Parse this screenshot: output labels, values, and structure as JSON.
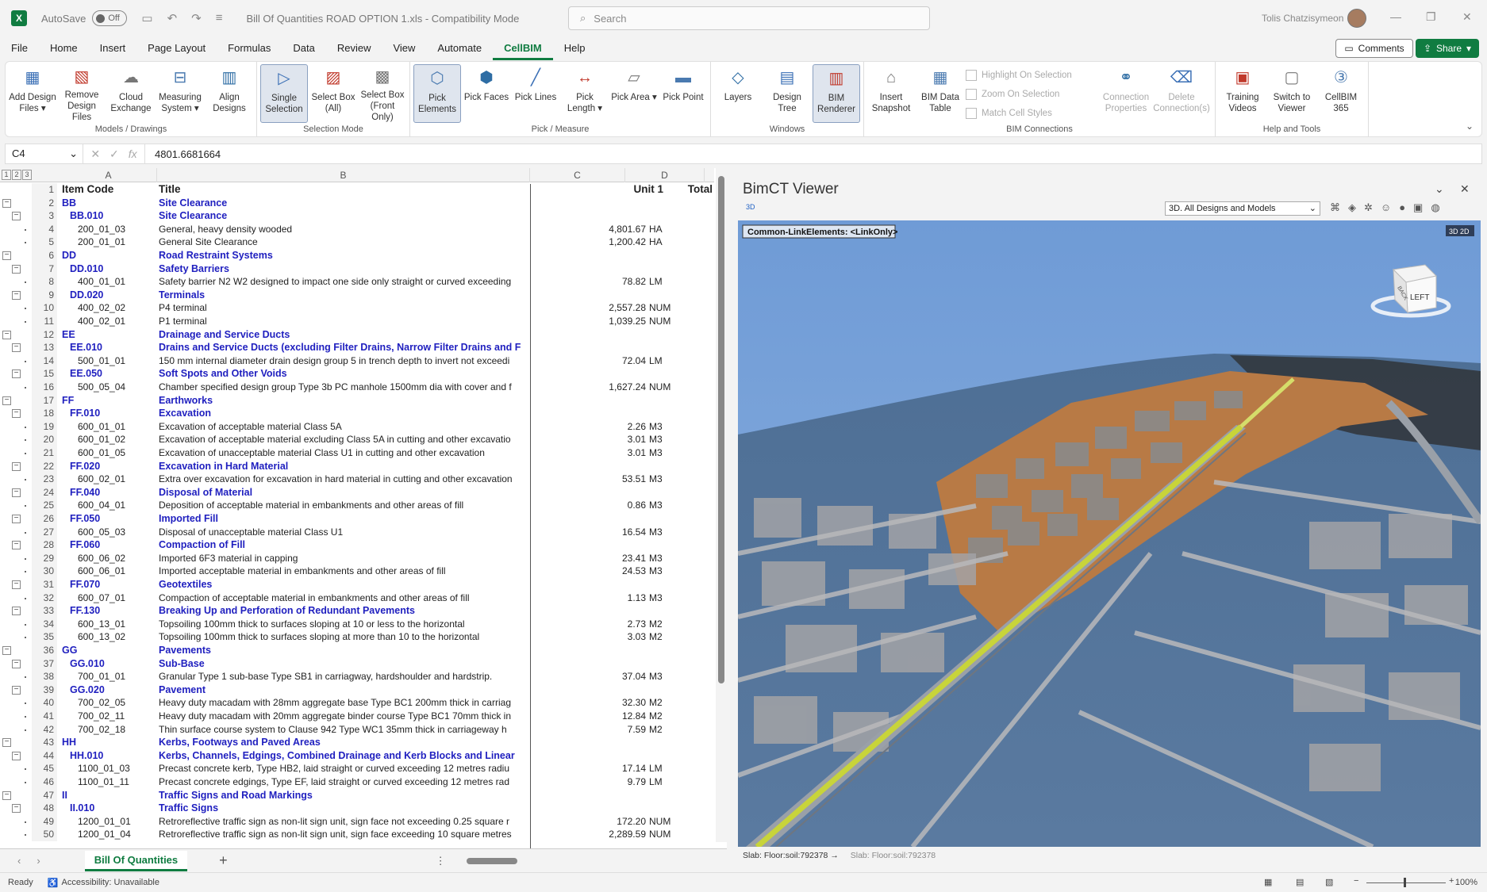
{
  "titlebar": {
    "app_logo": "X",
    "autosave_label": "AutoSave",
    "autosave_state": "Off",
    "doc_title": "Bill Of Quantities ROAD OPTION 1.xls - Compatibility Mode",
    "search_placeholder": "Search",
    "user_name": "Tolis Chatzisymeon"
  },
  "menu": {
    "items": [
      "File",
      "Home",
      "Insert",
      "Page Layout",
      "Formulas",
      "Data",
      "Review",
      "View",
      "Automate",
      "CellBIM",
      "Help"
    ],
    "active": "CellBIM",
    "comments_label": "Comments",
    "share_label": "Share"
  },
  "ribbon": {
    "groups": [
      {
        "label": "Models / Drawings",
        "buttons": [
          "Add Design Files ▾",
          "Remove Design Files",
          "Cloud Exchange",
          "Measuring System ▾",
          "Align Designs"
        ]
      },
      {
        "label": "Selection Mode",
        "buttons": [
          "Single Selection",
          "Select Box (All)",
          "Select Box (Front Only)"
        ]
      },
      {
        "label": "Pick / Measure",
        "buttons": [
          "Pick Elements",
          "Pick Faces",
          "Pick Lines",
          "Pick Length ▾",
          "Pick Area ▾",
          "Pick Point"
        ]
      },
      {
        "label": "Windows",
        "buttons": [
          "Layers",
          "Design Tree",
          "BIM Renderer"
        ]
      },
      {
        "label": "BIM Connections",
        "buttons": [
          "Insert Snapshot",
          "BIM Data Table",
          "Connection Properties",
          "Delete Connection(s)"
        ],
        "small": [
          "Highlight On Selection",
          "Zoom On Selection",
          "Match Cell Styles"
        ]
      },
      {
        "label": "Help and Tools",
        "buttons": [
          "Training Videos",
          "Switch to Viewer",
          "CellBIM 365"
        ]
      }
    ]
  },
  "formula_bar": {
    "name_box": "C4",
    "formula": "4801.6681664"
  },
  "sheet": {
    "columns": [
      "A",
      "B",
      "C",
      "D"
    ],
    "headers": {
      "a": "Item Code",
      "b": "Title",
      "unit": "Unit 1",
      "total": "Total"
    },
    "rows": [
      {
        "n": "2",
        "a": "BB",
        "b": "Site Clearance",
        "q": "",
        "u": "",
        "t": "h1"
      },
      {
        "n": "3",
        "a": "BB.010",
        "b": "Site Clearance",
        "q": "",
        "u": "",
        "t": "h2"
      },
      {
        "n": "4",
        "a": "200_01_03",
        "b": "General, heavy density wooded",
        "q": "4,801.67",
        "u": "HA",
        "t": ""
      },
      {
        "n": "5",
        "a": "200_01_01",
        "b": "General Site Clearance",
        "q": "1,200.42",
        "u": "HA",
        "t": ""
      },
      {
        "n": "6",
        "a": "DD",
        "b": "Road Restraint Systems",
        "q": "",
        "u": "",
        "t": "h1"
      },
      {
        "n": "7",
        "a": "DD.010",
        "b": "Safety Barriers",
        "q": "",
        "u": "",
        "t": "h2"
      },
      {
        "n": "8",
        "a": "400_01_01",
        "b": "Safety barrier N2 W2 designed to impact one side only straight or curved exceeding",
        "q": "78.82",
        "u": "LM",
        "t": ""
      },
      {
        "n": "9",
        "a": "DD.020",
        "b": "Terminals",
        "q": "",
        "u": "",
        "t": "h2"
      },
      {
        "n": "10",
        "a": "400_02_02",
        "b": "P4 terminal",
        "q": "2,557.28",
        "u": "NUM",
        "t": ""
      },
      {
        "n": "11",
        "a": "400_02_01",
        "b": "P1 terminal",
        "q": "1,039.25",
        "u": "NUM",
        "t": ""
      },
      {
        "n": "12",
        "a": "EE",
        "b": "Drainage and Service Ducts",
        "q": "",
        "u": "",
        "t": "h1"
      },
      {
        "n": "13",
        "a": "EE.010",
        "b": "Drains and Service Ducts (excluding Filter Drains, Narrow Filter Drains and F",
        "q": "",
        "u": "",
        "t": "h2"
      },
      {
        "n": "14",
        "a": "500_01_01",
        "b": "150 mm internal diameter drain design group 5 in trench depth to invert not exceedi",
        "q": "72.04",
        "u": "LM",
        "t": ""
      },
      {
        "n": "15",
        "a": "EE.050",
        "b": "Soft Spots and Other Voids",
        "q": "",
        "u": "",
        "t": "h2"
      },
      {
        "n": "16",
        "a": "500_05_04",
        "b": "Chamber specified design group Type 3b PC manhole 1500mm dia with cover and f",
        "q": "1,627.24",
        "u": "NUM",
        "t": ""
      },
      {
        "n": "17",
        "a": "FF",
        "b": "Earthworks",
        "q": "",
        "u": "",
        "t": "h1"
      },
      {
        "n": "18",
        "a": "FF.010",
        "b": "Excavation",
        "q": "",
        "u": "",
        "t": "h2"
      },
      {
        "n": "19",
        "a": "600_01_01",
        "b": "Excavation of acceptable material Class 5A",
        "q": "2.26",
        "u": "M3",
        "t": ""
      },
      {
        "n": "20",
        "a": "600_01_02",
        "b": "Excavation of acceptable material excluding Class 5A in cutting and other excavatio",
        "q": "3.01",
        "u": "M3",
        "t": ""
      },
      {
        "n": "21",
        "a": "600_01_05",
        "b": "Excavation of unacceptable material Class U1 in cutting and other excavation",
        "q": "3.01",
        "u": "M3",
        "t": ""
      },
      {
        "n": "22",
        "a": "FF.020",
        "b": "Excavation in Hard Material",
        "q": "",
        "u": "",
        "t": "h2"
      },
      {
        "n": "23",
        "a": "600_02_01",
        "b": "Extra over excavation for excavation in hard material in cutting and other excavation",
        "q": "53.51",
        "u": "M3",
        "t": ""
      },
      {
        "n": "24",
        "a": "FF.040",
        "b": "Disposal of Material",
        "q": "",
        "u": "",
        "t": "h2"
      },
      {
        "n": "25",
        "a": "600_04_01",
        "b": "Deposition of acceptable material in embankments and other areas of fill",
        "q": "0.86",
        "u": "M3",
        "t": ""
      },
      {
        "n": "26",
        "a": "FF.050",
        "b": "Imported Fill",
        "q": "",
        "u": "",
        "t": "h2"
      },
      {
        "n": "27",
        "a": "600_05_03",
        "b": "Disposal of unacceptable material Class U1",
        "q": "16.54",
        "u": "M3",
        "t": ""
      },
      {
        "n": "28",
        "a": "FF.060",
        "b": "Compaction of Fill",
        "q": "",
        "u": "",
        "t": "h2"
      },
      {
        "n": "29",
        "a": "600_06_02",
        "b": "Imported 6F3 material in capping",
        "q": "23.41",
        "u": "M3",
        "t": ""
      },
      {
        "n": "30",
        "a": "600_06_01",
        "b": "Imported acceptable material in embankments and other areas of fill",
        "q": "24.53",
        "u": "M3",
        "t": ""
      },
      {
        "n": "31",
        "a": "FF.070",
        "b": "Geotextiles",
        "q": "",
        "u": "",
        "t": "h2"
      },
      {
        "n": "32",
        "a": "600_07_01",
        "b": "Compaction of acceptable material in embankments and other areas of fill",
        "q": "1.13",
        "u": "M3",
        "t": ""
      },
      {
        "n": "33",
        "a": "FF.130",
        "b": "Breaking Up and Perforation of Redundant Pavements",
        "q": "",
        "u": "",
        "t": "h2"
      },
      {
        "n": "34",
        "a": "600_13_01",
        "b": "Topsoiling 100mm thick to surfaces sloping at 10 or less to the horizontal",
        "q": "2.73",
        "u": "M2",
        "t": ""
      },
      {
        "n": "35",
        "a": "600_13_02",
        "b": "Topsoiling 100mm thick to surfaces sloping at more than 10 to the horizontal",
        "q": "3.03",
        "u": "M2",
        "t": ""
      },
      {
        "n": "36",
        "a": "GG",
        "b": "Pavements",
        "q": "",
        "u": "",
        "t": "h1"
      },
      {
        "n": "37",
        "a": "GG.010",
        "b": "Sub-Base",
        "q": "",
        "u": "",
        "t": "h2"
      },
      {
        "n": "38",
        "a": "700_01_01",
        "b": "Granular Type 1 sub-base Type SB1 in carriagway, hardshoulder and hardstrip.",
        "q": "37.04",
        "u": "M3",
        "t": ""
      },
      {
        "n": "39",
        "a": "GG.020",
        "b": "Pavement",
        "q": "",
        "u": "",
        "t": "h2"
      },
      {
        "n": "40",
        "a": "700_02_05",
        "b": "Heavy duty macadam with 28mm aggregate base Type BC1 200mm thick in carriag",
        "q": "32.30",
        "u": "M2",
        "t": ""
      },
      {
        "n": "41",
        "a": "700_02_11",
        "b": "Heavy duty macadam with 20mm aggregate binder course Type BC1 70mm thick in",
        "q": "12.84",
        "u": "M2",
        "t": ""
      },
      {
        "n": "42",
        "a": "700_02_18",
        "b": "Thin surface course system to Clause 942 Type WC1 35mm thick in carriageway h",
        "q": "7.59",
        "u": "M2",
        "t": ""
      },
      {
        "n": "43",
        "a": "HH",
        "b": "Kerbs, Footways and Paved Areas",
        "q": "",
        "u": "",
        "t": "h1"
      },
      {
        "n": "44",
        "a": "HH.010",
        "b": "Kerbs, Channels, Edgings, Combined Drainage and Kerb Blocks and Linear",
        "q": "",
        "u": "",
        "t": "h2"
      },
      {
        "n": "45",
        "a": "1100_01_03",
        "b": "Precast concrete kerb, Type HB2, laid straight or curved exceeding 12 metres radiu",
        "q": "17.14",
        "u": "LM",
        "t": ""
      },
      {
        "n": "46",
        "a": "1100_01_11",
        "b": "Precast concrete edgings, Type EF, laid straight or curved exceeding 12 metres rad",
        "q": "9.79",
        "u": "LM",
        "t": ""
      },
      {
        "n": "47",
        "a": "II",
        "b": "Traffic Signs and Road Markings",
        "q": "",
        "u": "",
        "t": "h1"
      },
      {
        "n": "48",
        "a": "II.010",
        "b": "Traffic Signs",
        "q": "",
        "u": "",
        "t": "h2"
      },
      {
        "n": "49",
        "a": "1200_01_01",
        "b": "Retroreflective traffic sign as non-lit sign unit, sign face not exceeding 0.25 square r",
        "q": "172.20",
        "u": "NUM",
        "t": ""
      },
      {
        "n": "50",
        "a": "1200_01_04",
        "b": "Retroreflective traffic sign as non-lit sign unit, sign face exceeding 10 square metres",
        "q": "2,289.59",
        "u": "NUM",
        "t": ""
      }
    ],
    "tab_name": "Bill Of Quantities"
  },
  "viewer": {
    "title": "BimCT Viewer",
    "mode": "3D",
    "view_select": "3D. All Designs and Models",
    "label_box": "Common-LinkElements: <LinkOnly>",
    "badge": "3D 2D",
    "cube_face": "LEFT",
    "cube_side": "BACK",
    "status_main": "Slab: Floor:soil:792378 →",
    "status_hint": "Slab: Floor:soil:792378"
  },
  "statusbar": {
    "ready": "Ready",
    "accessibility": "Accessibility: Unavailable",
    "zoom": "100%"
  },
  "colors": {
    "excel_green": "#107c41",
    "heading_blue": "#1f1fbf",
    "road_yellow": "#c8d43a",
    "water_blue": "#4d6b8f",
    "land_orange": "#b87a45"
  }
}
